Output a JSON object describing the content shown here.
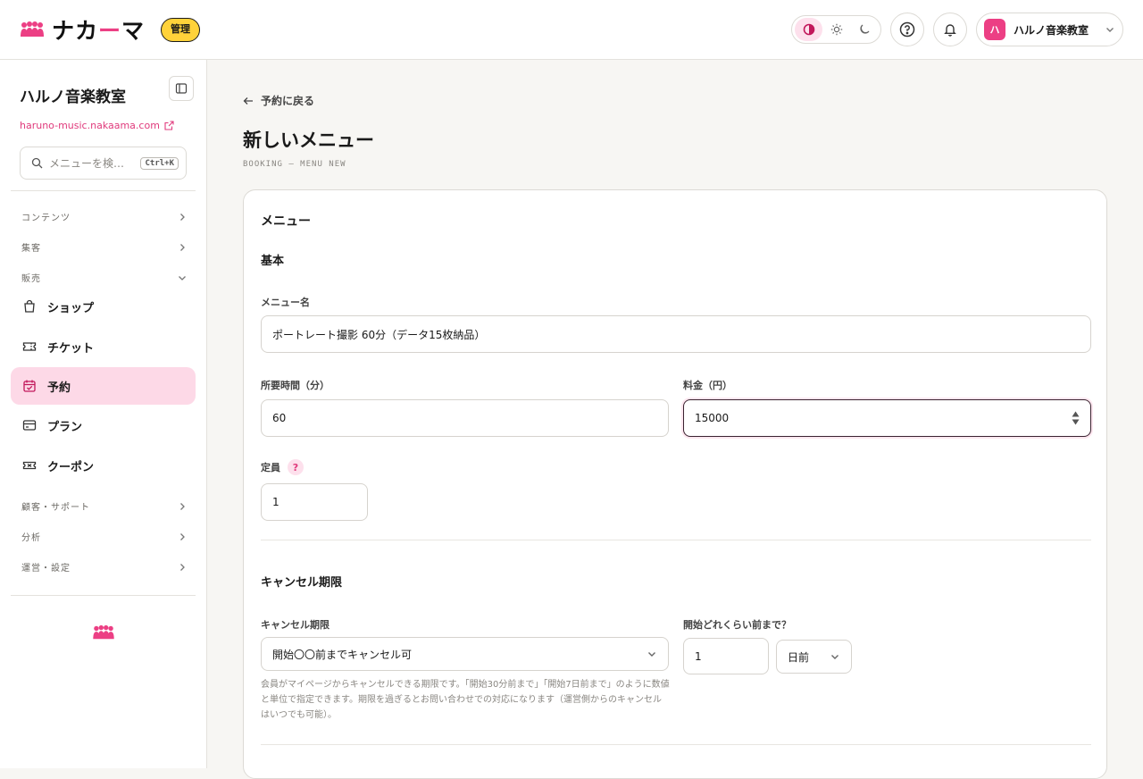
{
  "header": {
    "logo_text_1": "ナカ",
    "logo_text_accent": "ー",
    "logo_text_2": "マ",
    "admin_badge": "管理",
    "account": {
      "avatar_char": "ハ",
      "name": "ハルノ音楽教室"
    }
  },
  "sidebar": {
    "org_name": "ハルノ音楽教室",
    "org_url": "haruno-music.nakaama.com",
    "search": {
      "placeholder": "メニューを検…",
      "shortcut": "Ctrl+K"
    },
    "sections": {
      "content": "コンテンツ",
      "marketing": "集客",
      "sales": "販売",
      "customers": "顧客・サポート",
      "analytics": "分析",
      "settings": "運営・設定"
    },
    "items": {
      "shop": "ショップ",
      "ticket": "チケット",
      "booking": "予約",
      "plan": "プラン",
      "coupon": "クーポン"
    }
  },
  "main": {
    "back_link": "予約に戻る",
    "title": "新しいメニュー",
    "subtitle": "BOOKING — MENU NEW",
    "card_title": "メニュー",
    "basic": {
      "section": "基本",
      "menu_name_label": "メニュー名",
      "menu_name_value": "ポートレート撮影 60分（データ15枚納品）",
      "duration_label": "所要時間（分）",
      "duration_value": "60",
      "price_label": "料金（円）",
      "price_value": "15000",
      "capacity_label": "定員",
      "capacity_help": "?",
      "capacity_value": "1"
    },
    "cancel": {
      "section": "キャンセル期限",
      "deadline_label": "キャンセル期限",
      "deadline_value": "開始〇〇前までキャンセル可",
      "before_label": "開始どれくらい前まで？",
      "before_amount": "1",
      "before_unit": "日前",
      "help": "会員がマイページからキャンセルできる期限です。「開始30分前まで」「開始7日前まで」のように数値と単位で指定できます。期限を過ぎるとお問い合わせでの対応になります（運営側からのキャンセルはいつでも可能）。"
    }
  },
  "colors": {
    "accent": "#ec3f84",
    "active_bg": "#fdd9e7",
    "badge": "#ffd23a"
  }
}
